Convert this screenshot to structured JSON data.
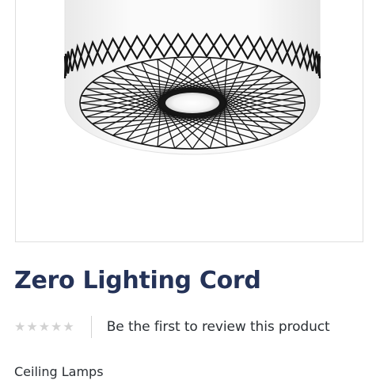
{
  "product": {
    "title": "Zero Lighting Cord",
    "image_icon": "ceiling-lamp-product-photo",
    "category": "Ceiling Lamps"
  },
  "reviews": {
    "rating_stars": 5,
    "rating_value": 0,
    "star_glyph": "★",
    "star_color": "#d2d2d2",
    "cta_label": "Be the first to review this product"
  },
  "colors": {
    "title": "#253358",
    "body_text": "#2b3035",
    "frame_border": "#dedede"
  }
}
